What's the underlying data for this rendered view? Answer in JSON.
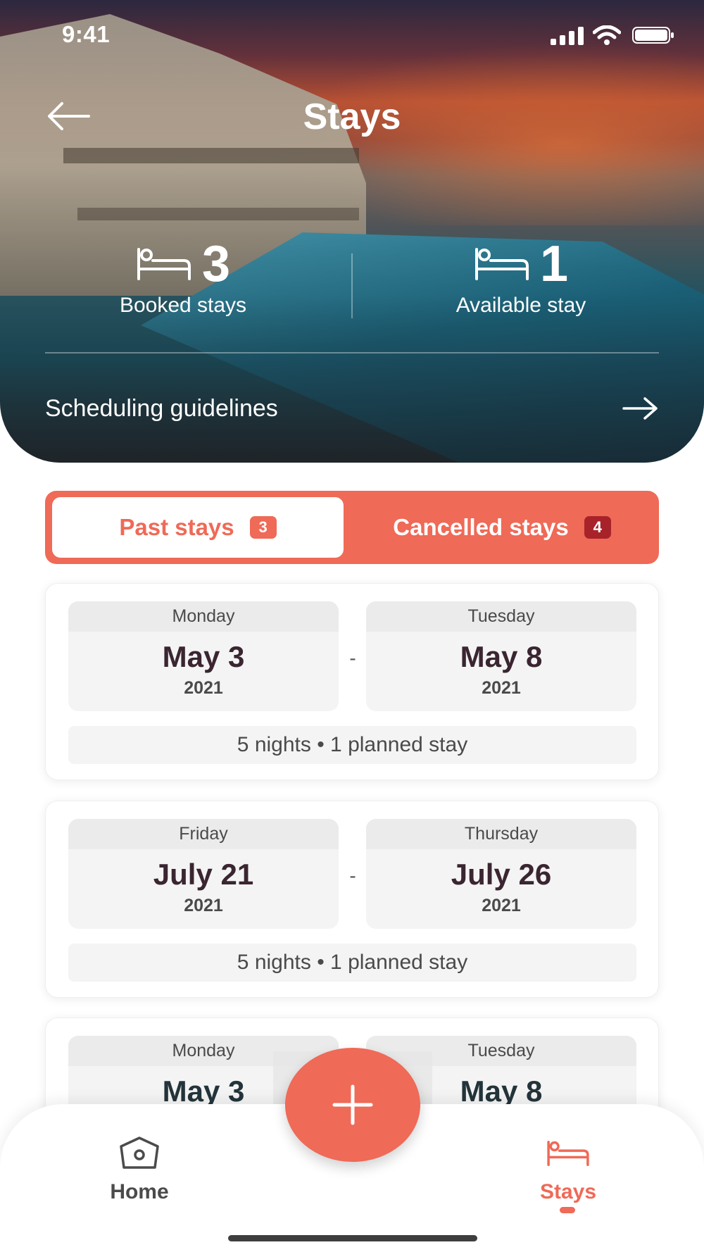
{
  "status_bar": {
    "time": "9:41"
  },
  "header": {
    "title": "Stays"
  },
  "stats": {
    "booked": {
      "value": "3",
      "label": "Booked stays"
    },
    "available": {
      "value": "1",
      "label": "Available stay"
    }
  },
  "guidelines": {
    "label": "Scheduling guidelines"
  },
  "tabs": [
    {
      "label": "Past stays",
      "count": "3",
      "active": true
    },
    {
      "label": "Cancelled stays",
      "count": "4",
      "active": false
    }
  ],
  "stays": [
    {
      "start": {
        "day": "Monday",
        "date": "May 3",
        "year": "2021"
      },
      "end": {
        "day": "Tuesday",
        "date": "May 8",
        "year": "2021"
      },
      "separator": "-",
      "summary": "5 nights • 1 planned stay"
    },
    {
      "start": {
        "day": "Friday",
        "date": "July 21",
        "year": "2021"
      },
      "end": {
        "day": "Thursday",
        "date": "July 26",
        "year": "2021"
      },
      "separator": "-",
      "summary": "5 nights • 1 planned stay"
    },
    {
      "start": {
        "day": "Monday",
        "date": "May 3",
        "year": ""
      },
      "end": {
        "day": "Tuesday",
        "date": "May 8",
        "year": ""
      },
      "separator": "",
      "summary": ""
    }
  ],
  "bottom_nav": {
    "home": {
      "label": "Home",
      "icon": "home-icon"
    },
    "stays": {
      "label": "Stays",
      "icon": "bed-icon"
    },
    "fab_icon": "plus-icon"
  },
  "colors": {
    "accent": "#ef6a57",
    "badge_dark": "#a8222a",
    "text_dark": "#3a2530"
  }
}
